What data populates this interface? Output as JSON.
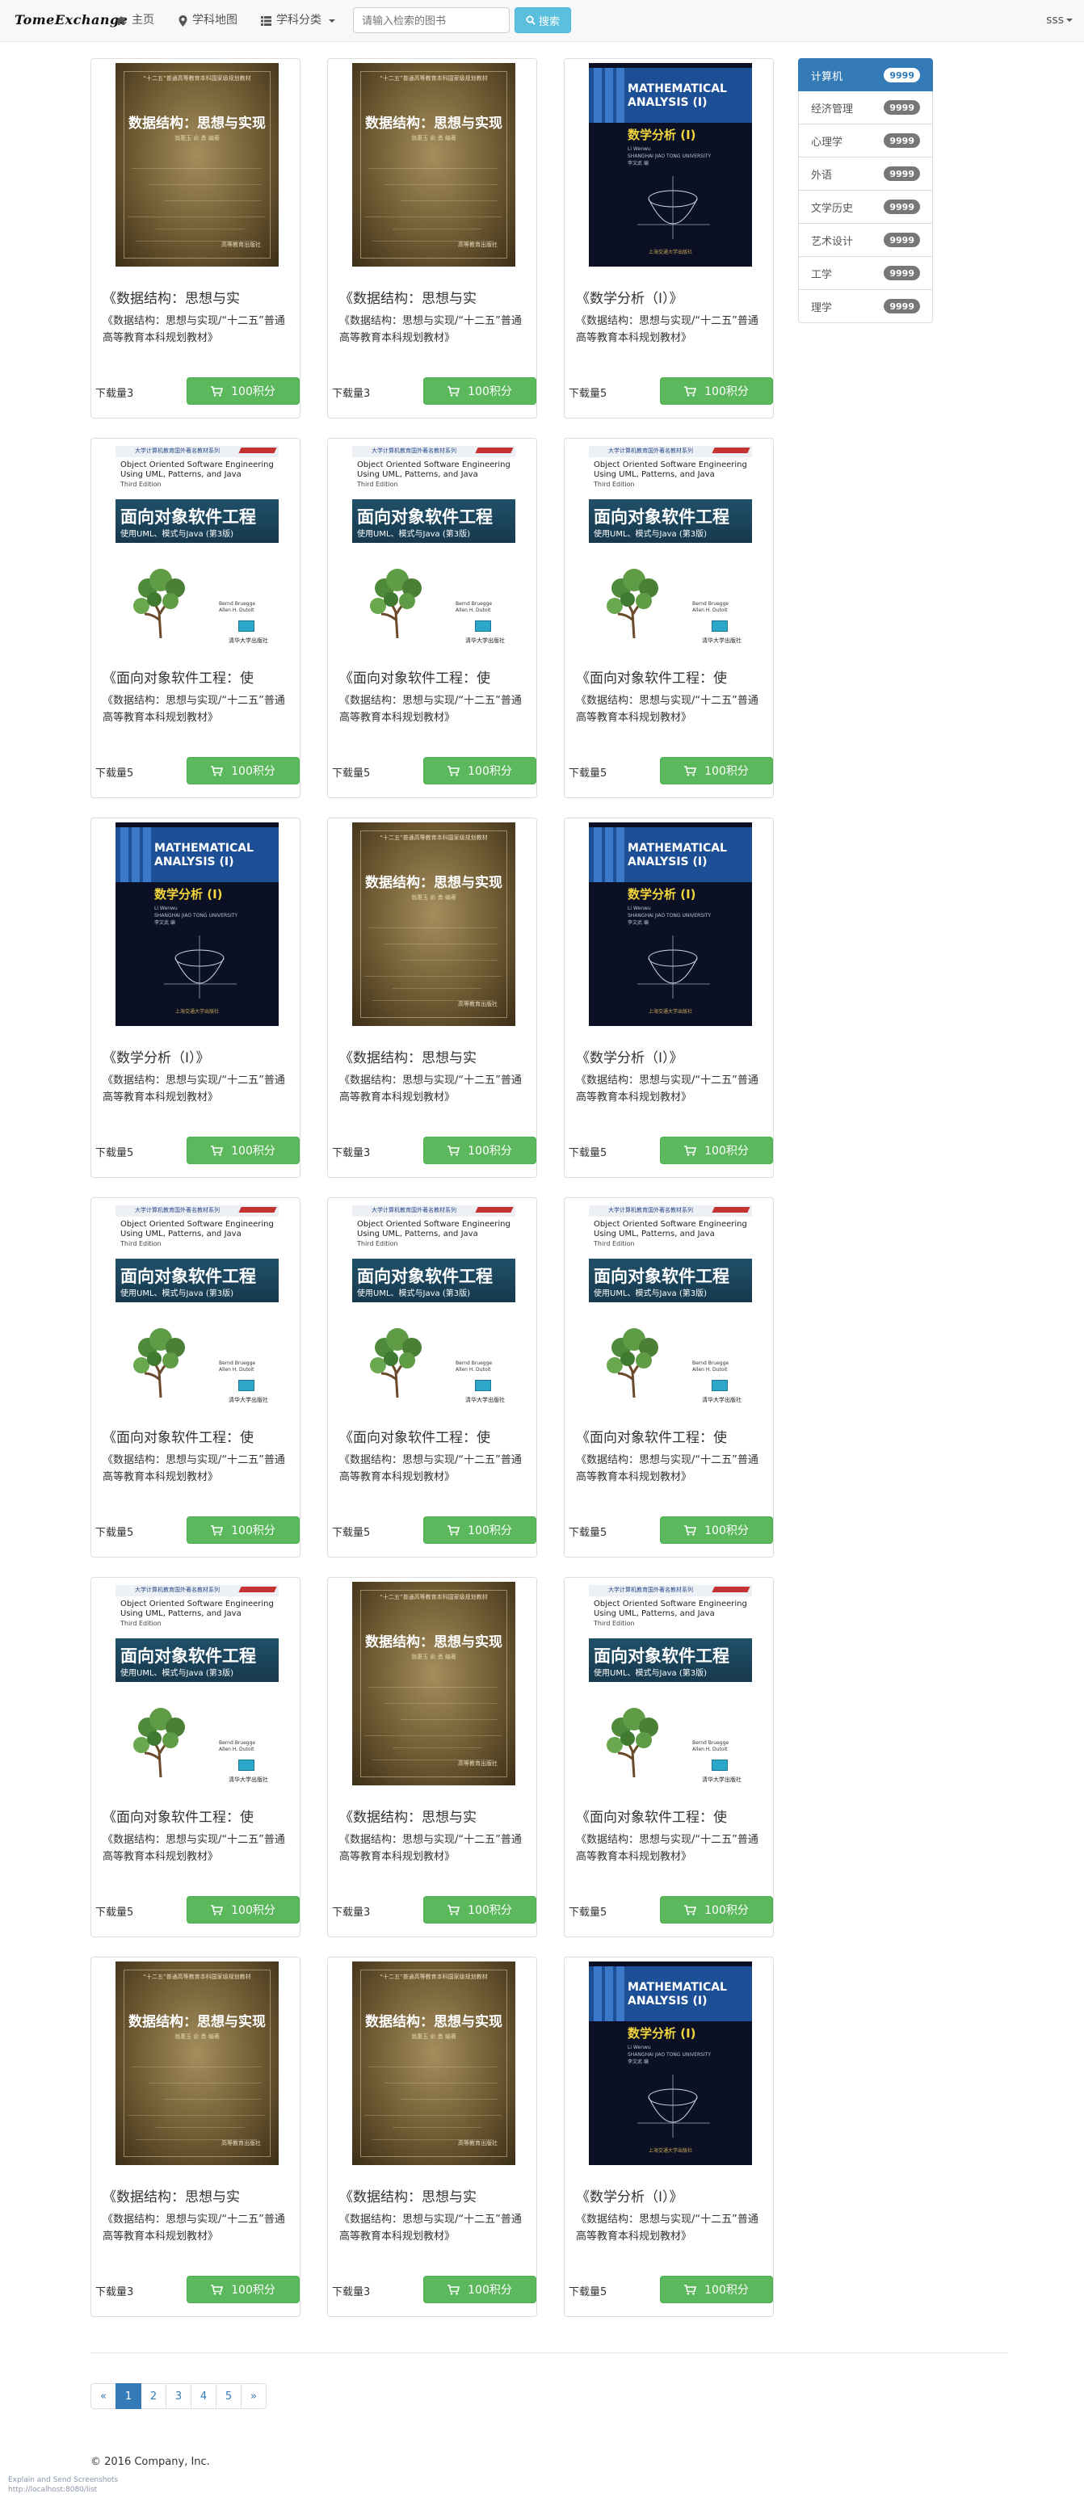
{
  "navbar": {
    "brand": "TomeExchange",
    "home": "主页",
    "map": "学科地图",
    "categories": "学科分类",
    "search_placeholder": "请输入检索的图书",
    "search_button": "搜索",
    "user": "sss"
  },
  "books": [
    {
      "title": "《数据结构：思想与实",
      "desc": "《数据结构：思想与实现/“十二五”普通高等教育本科规划教材》",
      "downloads": "下载量3",
      "price": "100积分",
      "cover": "ds"
    },
    {
      "title": "《数据结构：思想与实",
      "desc": "《数据结构：思想与实现/“十二五”普通高等教育本科规划教材》",
      "downloads": "下载量3",
      "price": "100积分",
      "cover": "ds"
    },
    {
      "title": "《数学分析（Ⅰ）》",
      "desc": "《数据结构：思想与实现/“十二五”普通高等教育本科规划教材》",
      "downloads": "下载量5",
      "price": "100积分",
      "cover": "ma"
    },
    {
      "title": "《面向对象软件工程：使",
      "desc": "《数据结构：思想与实现/“十二五”普通高等教育本科规划教材》",
      "downloads": "下载量5",
      "price": "100积分",
      "cover": "oo"
    },
    {
      "title": "《面向对象软件工程：使",
      "desc": "《数据结构：思想与实现/“十二五”普通高等教育本科规划教材》",
      "downloads": "下载量5",
      "price": "100积分",
      "cover": "oo"
    },
    {
      "title": "《面向对象软件工程：使",
      "desc": "《数据结构：思想与实现/“十二五”普通高等教育本科规划教材》",
      "downloads": "下载量5",
      "price": "100积分",
      "cover": "oo"
    },
    {
      "title": "《数学分析（Ⅰ）》",
      "desc": "《数据结构：思想与实现/“十二五”普通高等教育本科规划教材》",
      "downloads": "下载量5",
      "price": "100积分",
      "cover": "ma"
    },
    {
      "title": "《数据结构：思想与实",
      "desc": "《数据结构：思想与实现/“十二五”普通高等教育本科规划教材》",
      "downloads": "下载量3",
      "price": "100积分",
      "cover": "ds"
    },
    {
      "title": "《数学分析（Ⅰ）》",
      "desc": "《数据结构：思想与实现/“十二五”普通高等教育本科规划教材》",
      "downloads": "下载量5",
      "price": "100积分",
      "cover": "ma"
    },
    {
      "title": "《面向对象软件工程：使",
      "desc": "《数据结构：思想与实现/“十二五”普通高等教育本科规划教材》",
      "downloads": "下载量5",
      "price": "100积分",
      "cover": "oo"
    },
    {
      "title": "《面向对象软件工程：使",
      "desc": "《数据结构：思想与实现/“十二五”普通高等教育本科规划教材》",
      "downloads": "下载量5",
      "price": "100积分",
      "cover": "oo"
    },
    {
      "title": "《面向对象软件工程：使",
      "desc": "《数据结构：思想与实现/“十二五”普通高等教育本科规划教材》",
      "downloads": "下载量5",
      "price": "100积分",
      "cover": "oo"
    },
    {
      "title": "《面向对象软件工程：使",
      "desc": "《数据结构：思想与实现/“十二五”普通高等教育本科规划教材》",
      "downloads": "下载量5",
      "price": "100积分",
      "cover": "oo"
    },
    {
      "title": "《数据结构：思想与实",
      "desc": "《数据结构：思想与实现/“十二五”普通高等教育本科规划教材》",
      "downloads": "下载量3",
      "price": "100积分",
      "cover": "ds"
    },
    {
      "title": "《面向对象软件工程：使",
      "desc": "《数据结构：思想与实现/“十二五”普通高等教育本科规划教材》",
      "downloads": "下载量5",
      "price": "100积分",
      "cover": "oo"
    },
    {
      "title": "《数据结构：思想与实",
      "desc": "《数据结构：思想与实现/“十二五”普通高等教育本科规划教材》",
      "downloads": "下载量3",
      "price": "100积分",
      "cover": "ds"
    },
    {
      "title": "《数据结构：思想与实",
      "desc": "《数据结构：思想与实现/“十二五”普通高等教育本科规划教材》",
      "downloads": "下载量3",
      "price": "100积分",
      "cover": "ds"
    },
    {
      "title": "《数学分析（Ⅰ）》",
      "desc": "《数据结构：思想与实现/“十二五”普通高等教育本科规划教材》",
      "downloads": "下载量5",
      "price": "100积分",
      "cover": "ma"
    }
  ],
  "covers": {
    "ds": {
      "series": "“十二五”普通高等教育本科国家级规划教材",
      "title": "数据结构：思想与实现",
      "authors": "翁惠玉  俞  勇  编著",
      "publisher": "高等教育出版社"
    },
    "ma": {
      "en_line1": "MATHEMATICAL",
      "en_line2": "ANALYSIS (I)",
      "cn": "数学分析 (I)",
      "author_en": "Li Wenwu",
      "author_en2": "SHANGHAI JIAO TONG UNIVERSITY",
      "author_cn": "李文武  编",
      "publisher": "上海交通大学出版社"
    },
    "oo": {
      "series": "大学计算机教育国外著名教材系列",
      "en1": "Object Oriented Software Engineering",
      "en2": "Using UML, Patterns, and Java",
      "edition": "Third Edition",
      "cn": "面向对象软件工程",
      "cn2": "使用UML、模式与Java (第3版)",
      "author1": "Bernd Bruegge",
      "author2": "Allen H. Dutoit",
      "publisher": "清华大学出版社"
    }
  },
  "sidebar": {
    "items": [
      {
        "label": "计算机",
        "count": "9999",
        "active": true
      },
      {
        "label": "经济管理",
        "count": "9999"
      },
      {
        "label": "心理学",
        "count": "9999"
      },
      {
        "label": "外语",
        "count": "9999"
      },
      {
        "label": "文学历史",
        "count": "9999"
      },
      {
        "label": "艺术设计",
        "count": "9999"
      },
      {
        "label": "工学",
        "count": "9999"
      },
      {
        "label": "理学",
        "count": "9999"
      }
    ]
  },
  "pagination": {
    "prev": "«",
    "pages": [
      "1",
      "2",
      "3",
      "4",
      "5"
    ],
    "next": "»",
    "active": "1"
  },
  "footer": {
    "copyright": "© 2016 Company, Inc.",
    "watermark_line1": "Explain and Send Screenshots",
    "watermark_line2": "http://localhost:8080/list"
  },
  "colors": {
    "primary": "#337ab7",
    "success": "#5cb85c",
    "info": "#5bc0de",
    "badge": "#777777"
  },
  "icons": {
    "home": "home-icon",
    "map": "map-marker-icon",
    "categories": "list-icon",
    "search": "search-icon",
    "cart": "shopping-cart-icon"
  }
}
